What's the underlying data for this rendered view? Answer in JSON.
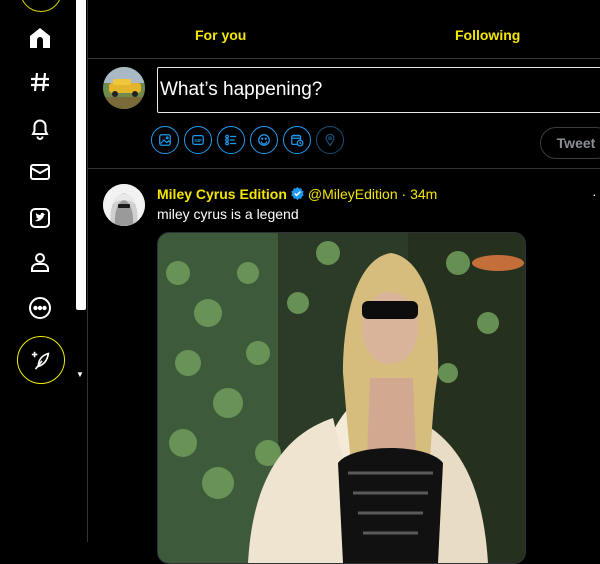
{
  "sidebar": {
    "items": [
      {
        "name": "home-icon"
      },
      {
        "name": "explore-hash-icon"
      },
      {
        "name": "notifications-bell-icon"
      },
      {
        "name": "messages-mail-icon"
      },
      {
        "name": "bookmarks-bird-icon"
      },
      {
        "name": "profile-person-icon"
      },
      {
        "name": "more-icon"
      }
    ],
    "compose_icon": "feather-plus-icon",
    "accent": "#f0f000"
  },
  "tabs": [
    {
      "label": "For you"
    },
    {
      "label": "Following"
    }
  ],
  "composer": {
    "placeholder": "What’s happening?",
    "tools": [
      "image-icon",
      "gif-icon",
      "poll-icon",
      "emoji-icon",
      "schedule-icon",
      "location-icon"
    ],
    "tweet_button": "Tweet"
  },
  "tweet": {
    "name": "Miley Cyrus Edition",
    "handle": "@MileyEdition",
    "separator": "·",
    "time": "34m",
    "text": "miley cyrus is a legend",
    "more": "·"
  },
  "colors": {
    "accent_yellow": "#f5e600",
    "tool_blue": "#1d9bf0",
    "background": "#000000",
    "border": "#2f3336"
  }
}
